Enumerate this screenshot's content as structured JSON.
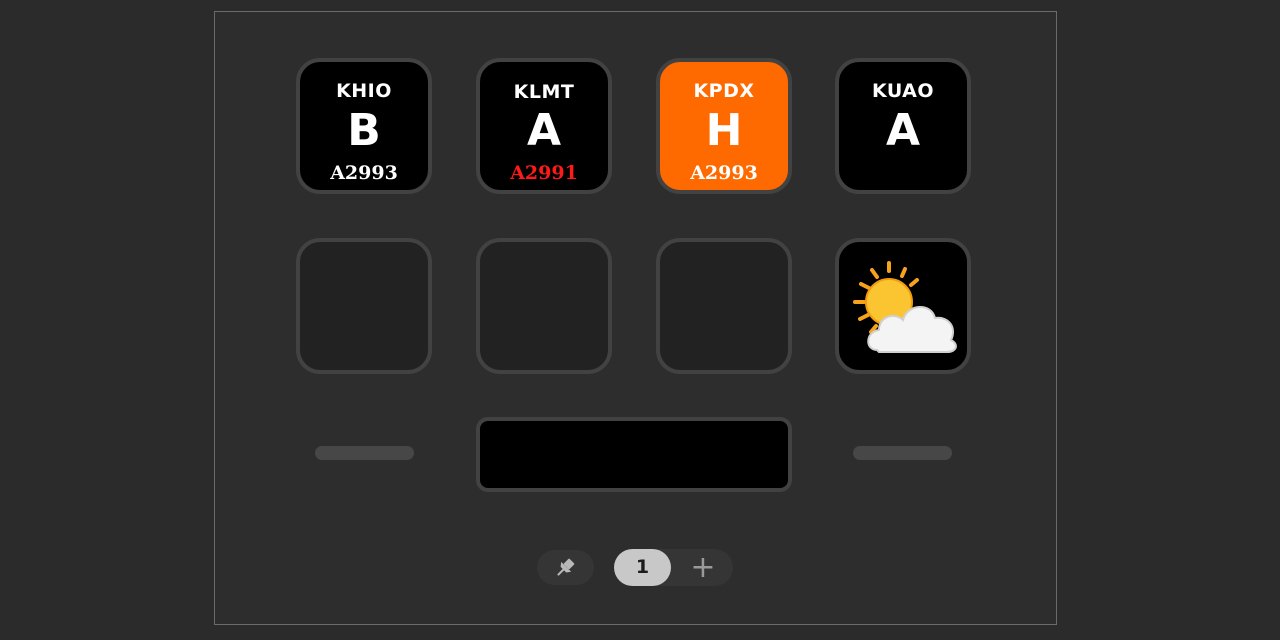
{
  "keys": {
    "khio": {
      "code": "KHIO",
      "category": "B",
      "altimeter": "A2993"
    },
    "klmt": {
      "code": "KLMT",
      "category": "A",
      "altimeter": "A2991"
    },
    "kpdx": {
      "code": "KPDX",
      "category": "H",
      "altimeter": "A2993"
    },
    "kuao": {
      "code": "KUAO",
      "category": "A"
    }
  },
  "weather_key": {
    "icon": "sun-behind-cloud-icon"
  },
  "pager": {
    "current_page": "1",
    "add_label": "+"
  },
  "colors": {
    "alert": "#ff6a00",
    "warning_text": "#ff1a1a",
    "key_black": "#000000",
    "key_empty": "#222222"
  }
}
